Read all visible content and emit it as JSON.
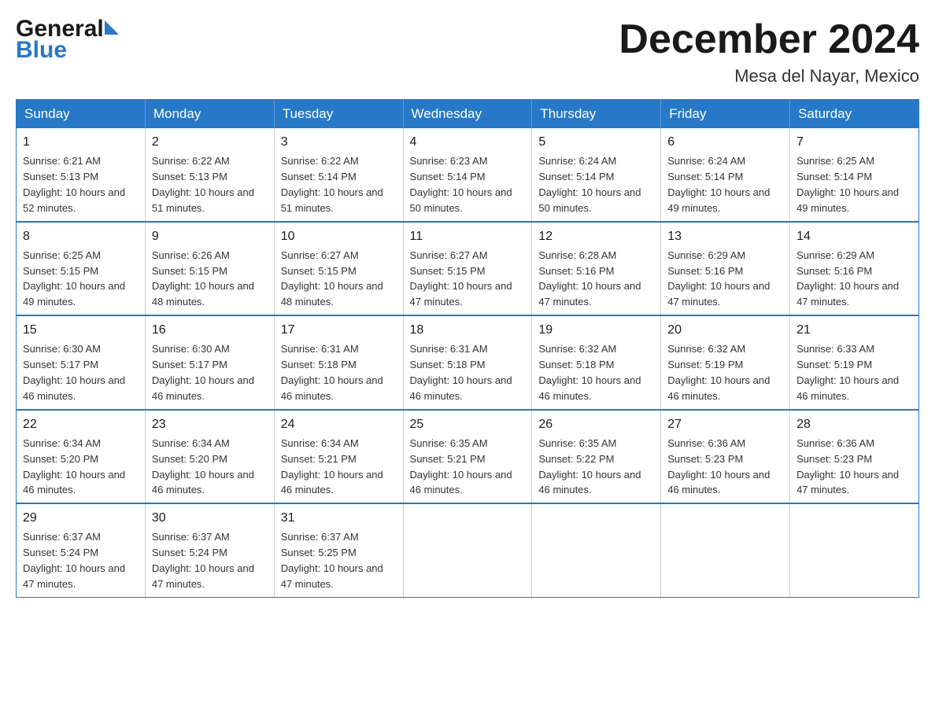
{
  "header": {
    "logo_general": "General",
    "logo_blue": "Blue",
    "month_title": "December 2024",
    "location": "Mesa del Nayar, Mexico"
  },
  "weekdays": [
    "Sunday",
    "Monday",
    "Tuesday",
    "Wednesday",
    "Thursday",
    "Friday",
    "Saturday"
  ],
  "weeks": [
    [
      {
        "day": "1",
        "sunrise": "6:21 AM",
        "sunset": "5:13 PM",
        "daylight": "10 hours and 52 minutes."
      },
      {
        "day": "2",
        "sunrise": "6:22 AM",
        "sunset": "5:13 PM",
        "daylight": "10 hours and 51 minutes."
      },
      {
        "day": "3",
        "sunrise": "6:22 AM",
        "sunset": "5:14 PM",
        "daylight": "10 hours and 51 minutes."
      },
      {
        "day": "4",
        "sunrise": "6:23 AM",
        "sunset": "5:14 PM",
        "daylight": "10 hours and 50 minutes."
      },
      {
        "day": "5",
        "sunrise": "6:24 AM",
        "sunset": "5:14 PM",
        "daylight": "10 hours and 50 minutes."
      },
      {
        "day": "6",
        "sunrise": "6:24 AM",
        "sunset": "5:14 PM",
        "daylight": "10 hours and 49 minutes."
      },
      {
        "day": "7",
        "sunrise": "6:25 AM",
        "sunset": "5:14 PM",
        "daylight": "10 hours and 49 minutes."
      }
    ],
    [
      {
        "day": "8",
        "sunrise": "6:25 AM",
        "sunset": "5:15 PM",
        "daylight": "10 hours and 49 minutes."
      },
      {
        "day": "9",
        "sunrise": "6:26 AM",
        "sunset": "5:15 PM",
        "daylight": "10 hours and 48 minutes."
      },
      {
        "day": "10",
        "sunrise": "6:27 AM",
        "sunset": "5:15 PM",
        "daylight": "10 hours and 48 minutes."
      },
      {
        "day": "11",
        "sunrise": "6:27 AM",
        "sunset": "5:15 PM",
        "daylight": "10 hours and 47 minutes."
      },
      {
        "day": "12",
        "sunrise": "6:28 AM",
        "sunset": "5:16 PM",
        "daylight": "10 hours and 47 minutes."
      },
      {
        "day": "13",
        "sunrise": "6:29 AM",
        "sunset": "5:16 PM",
        "daylight": "10 hours and 47 minutes."
      },
      {
        "day": "14",
        "sunrise": "6:29 AM",
        "sunset": "5:16 PM",
        "daylight": "10 hours and 47 minutes."
      }
    ],
    [
      {
        "day": "15",
        "sunrise": "6:30 AM",
        "sunset": "5:17 PM",
        "daylight": "10 hours and 46 minutes."
      },
      {
        "day": "16",
        "sunrise": "6:30 AM",
        "sunset": "5:17 PM",
        "daylight": "10 hours and 46 minutes."
      },
      {
        "day": "17",
        "sunrise": "6:31 AM",
        "sunset": "5:18 PM",
        "daylight": "10 hours and 46 minutes."
      },
      {
        "day": "18",
        "sunrise": "6:31 AM",
        "sunset": "5:18 PM",
        "daylight": "10 hours and 46 minutes."
      },
      {
        "day": "19",
        "sunrise": "6:32 AM",
        "sunset": "5:18 PM",
        "daylight": "10 hours and 46 minutes."
      },
      {
        "day": "20",
        "sunrise": "6:32 AM",
        "sunset": "5:19 PM",
        "daylight": "10 hours and 46 minutes."
      },
      {
        "day": "21",
        "sunrise": "6:33 AM",
        "sunset": "5:19 PM",
        "daylight": "10 hours and 46 minutes."
      }
    ],
    [
      {
        "day": "22",
        "sunrise": "6:34 AM",
        "sunset": "5:20 PM",
        "daylight": "10 hours and 46 minutes."
      },
      {
        "day": "23",
        "sunrise": "6:34 AM",
        "sunset": "5:20 PM",
        "daylight": "10 hours and 46 minutes."
      },
      {
        "day": "24",
        "sunrise": "6:34 AM",
        "sunset": "5:21 PM",
        "daylight": "10 hours and 46 minutes."
      },
      {
        "day": "25",
        "sunrise": "6:35 AM",
        "sunset": "5:21 PM",
        "daylight": "10 hours and 46 minutes."
      },
      {
        "day": "26",
        "sunrise": "6:35 AM",
        "sunset": "5:22 PM",
        "daylight": "10 hours and 46 minutes."
      },
      {
        "day": "27",
        "sunrise": "6:36 AM",
        "sunset": "5:23 PM",
        "daylight": "10 hours and 46 minutes."
      },
      {
        "day": "28",
        "sunrise": "6:36 AM",
        "sunset": "5:23 PM",
        "daylight": "10 hours and 47 minutes."
      }
    ],
    [
      {
        "day": "29",
        "sunrise": "6:37 AM",
        "sunset": "5:24 PM",
        "daylight": "10 hours and 47 minutes."
      },
      {
        "day": "30",
        "sunrise": "6:37 AM",
        "sunset": "5:24 PM",
        "daylight": "10 hours and 47 minutes."
      },
      {
        "day": "31",
        "sunrise": "6:37 AM",
        "sunset": "5:25 PM",
        "daylight": "10 hours and 47 minutes."
      },
      null,
      null,
      null,
      null
    ]
  ]
}
